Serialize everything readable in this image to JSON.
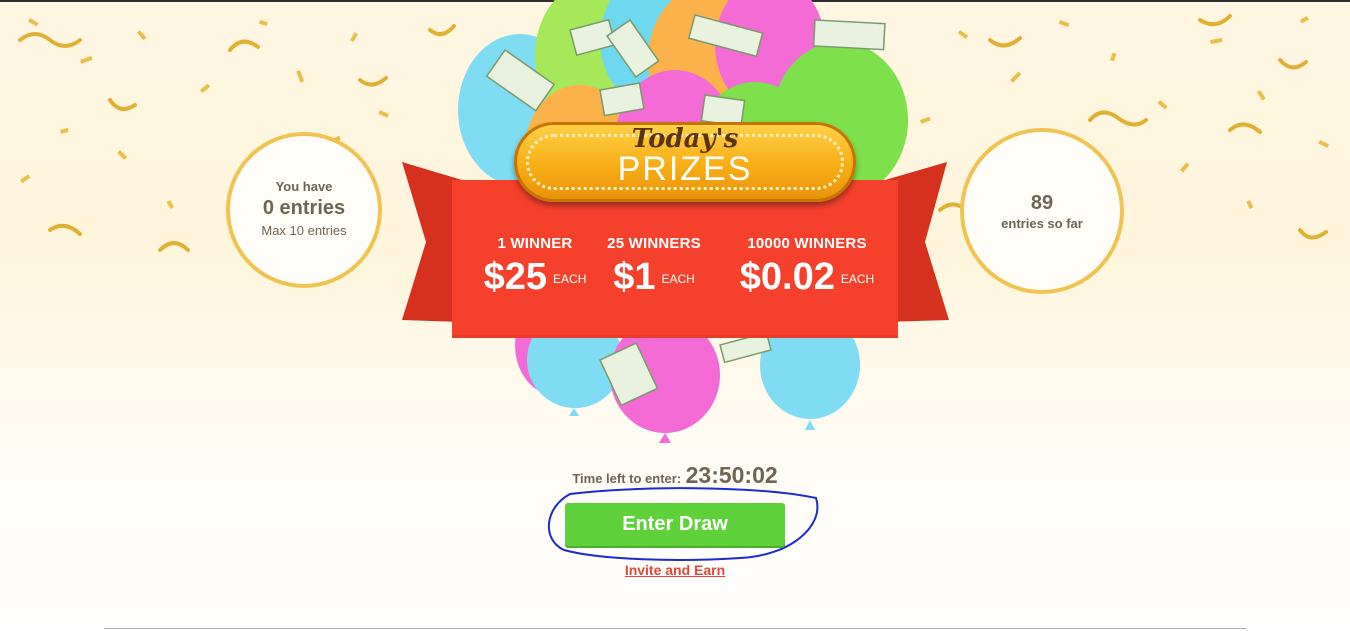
{
  "entries_circle": {
    "line1": "You have",
    "entries": "0 entries",
    "max": "Max 10 entries"
  },
  "sofar_circle": {
    "count": "89",
    "label": "entries so far"
  },
  "prizes_badge": {
    "today": "Today's",
    "prizes": "PRIZES"
  },
  "prizes": [
    {
      "winners": "1 WINNER",
      "amount": "$25",
      "each": "EACH"
    },
    {
      "winners": "25 WINNERS",
      "amount": "$1",
      "each": "EACH"
    },
    {
      "winners": "10000 WINNERS",
      "amount": "$0.02",
      "each": "EACH"
    }
  ],
  "timer": {
    "label": "Time left to enter:",
    "value": "23:50:02"
  },
  "enter_button": "Enter Draw",
  "invite_link": "Invite and Earn",
  "colors": {
    "banner_red": "#f5412c",
    "button_green": "#5fd13a",
    "circle_gold": "#f0c453",
    "link_red": "#e2473a",
    "annotation_blue": "#1a2bd1"
  },
  "icons": [
    "confetti-decoration",
    "balloons-decoration",
    "money-bills-decoration"
  ]
}
